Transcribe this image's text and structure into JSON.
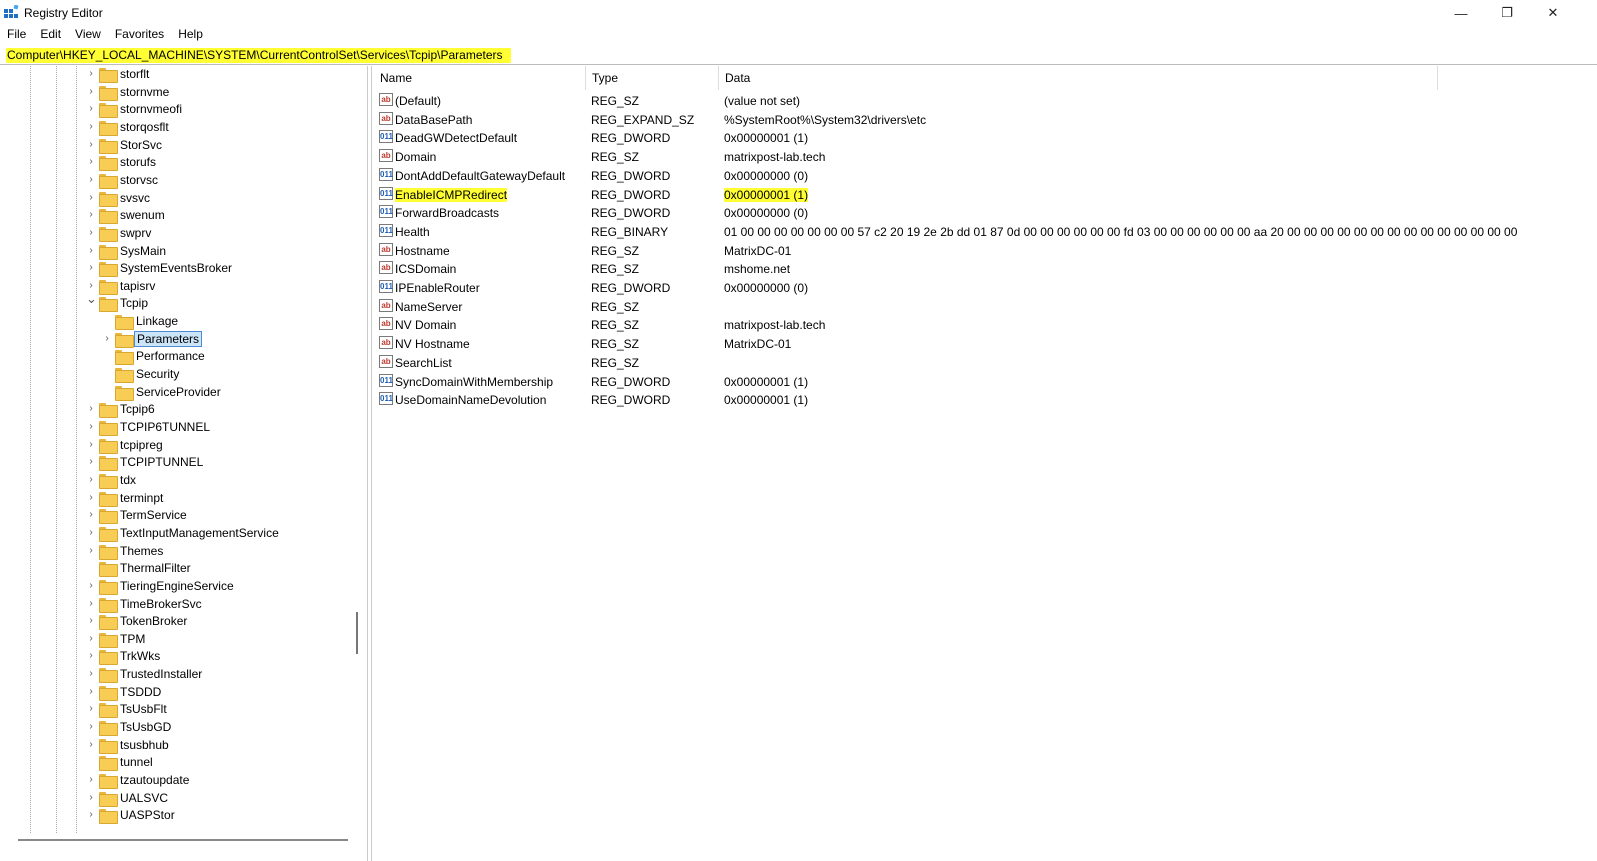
{
  "window": {
    "title": "Registry Editor",
    "minimize_glyph": "—",
    "maximize_glyph": "❐",
    "close_glyph": "✕"
  },
  "menu": [
    "File",
    "Edit",
    "View",
    "Favorites",
    "Help"
  ],
  "address": {
    "path": "Computer\\HKEY_LOCAL_MACHINE\\SYSTEM\\CurrentControlSet\\Services\\Tcpip\\Parameters",
    "highlight_color": "#ffff33"
  },
  "tree": {
    "items": [
      {
        "label": "storflt",
        "expandable": true,
        "level": 0
      },
      {
        "label": "stornvme",
        "expandable": true,
        "level": 0
      },
      {
        "label": "stornvmeofi",
        "expandable": true,
        "level": 0
      },
      {
        "label": "storqosflt",
        "expandable": true,
        "level": 0
      },
      {
        "label": "StorSvc",
        "expandable": true,
        "level": 0
      },
      {
        "label": "storufs",
        "expandable": true,
        "level": 0
      },
      {
        "label": "storvsc",
        "expandable": true,
        "level": 0
      },
      {
        "label": "svsvc",
        "expandable": true,
        "level": 0
      },
      {
        "label": "swenum",
        "expandable": true,
        "level": 0
      },
      {
        "label": "swprv",
        "expandable": true,
        "level": 0
      },
      {
        "label": "SysMain",
        "expandable": true,
        "level": 0
      },
      {
        "label": "SystemEventsBroker",
        "expandable": true,
        "level": 0
      },
      {
        "label": "tapisrv",
        "expandable": true,
        "level": 0
      },
      {
        "label": "Tcpip",
        "expandable": true,
        "expanded": true,
        "level": 0
      },
      {
        "label": "Linkage",
        "expandable": false,
        "level": 1
      },
      {
        "label": "Parameters",
        "expandable": true,
        "level": 1,
        "selected": true
      },
      {
        "label": "Performance",
        "expandable": false,
        "level": 1
      },
      {
        "label": "Security",
        "expandable": false,
        "level": 1
      },
      {
        "label": "ServiceProvider",
        "expandable": false,
        "level": 1
      },
      {
        "label": "Tcpip6",
        "expandable": true,
        "level": 0
      },
      {
        "label": "TCPIP6TUNNEL",
        "expandable": true,
        "level": 0
      },
      {
        "label": "tcpipreg",
        "expandable": true,
        "level": 0
      },
      {
        "label": "TCPIPTUNNEL",
        "expandable": true,
        "level": 0
      },
      {
        "label": "tdx",
        "expandable": true,
        "level": 0
      },
      {
        "label": "terminpt",
        "expandable": true,
        "level": 0
      },
      {
        "label": "TermService",
        "expandable": true,
        "level": 0
      },
      {
        "label": "TextInputManagementService",
        "expandable": true,
        "level": 0
      },
      {
        "label": "Themes",
        "expandable": true,
        "level": 0
      },
      {
        "label": "ThermalFilter",
        "expandable": false,
        "level": 0
      },
      {
        "label": "TieringEngineService",
        "expandable": true,
        "level": 0
      },
      {
        "label": "TimeBrokerSvc",
        "expandable": true,
        "level": 0
      },
      {
        "label": "TokenBroker",
        "expandable": true,
        "level": 0
      },
      {
        "label": "TPM",
        "expandable": true,
        "level": 0
      },
      {
        "label": "TrkWks",
        "expandable": true,
        "level": 0
      },
      {
        "label": "TrustedInstaller",
        "expandable": true,
        "level": 0
      },
      {
        "label": "TSDDD",
        "expandable": true,
        "level": 0
      },
      {
        "label": "TsUsbFlt",
        "expandable": true,
        "level": 0
      },
      {
        "label": "TsUsbGD",
        "expandable": true,
        "level": 0
      },
      {
        "label": "tsusbhub",
        "expandable": true,
        "level": 0
      },
      {
        "label": "tunnel",
        "expandable": false,
        "level": 0
      },
      {
        "label": "tzautoupdate",
        "expandable": true,
        "level": 0
      },
      {
        "label": "UALSVC",
        "expandable": true,
        "level": 0
      },
      {
        "label": "UASPStor",
        "expandable": true,
        "level": 0
      }
    ]
  },
  "list": {
    "headers": {
      "name": "Name",
      "type": "Type",
      "data": "Data"
    },
    "rows": [
      {
        "name": "(Default)",
        "type": "REG_SZ",
        "data": "(value not set)",
        "icon": "string-value-icon"
      },
      {
        "name": "DataBasePath",
        "type": "REG_EXPAND_SZ",
        "data": "%SystemRoot%\\System32\\drivers\\etc",
        "icon": "string-value-icon"
      },
      {
        "name": "DeadGWDetectDefault",
        "type": "REG_DWORD",
        "data": "0x00000001 (1)",
        "icon": "binary-value-icon"
      },
      {
        "name": "Domain",
        "type": "REG_SZ",
        "data": "matrixpost-lab.tech",
        "icon": "string-value-icon"
      },
      {
        "name": "DontAddDefaultGatewayDefault",
        "type": "REG_DWORD",
        "data": "0x00000000 (0)",
        "icon": "binary-value-icon"
      },
      {
        "name": "EnableICMPRedirect",
        "type": "REG_DWORD",
        "data": "0x00000001 (1)",
        "icon": "binary-value-icon",
        "highlighted": true
      },
      {
        "name": "ForwardBroadcasts",
        "type": "REG_DWORD",
        "data": "0x00000000 (0)",
        "icon": "binary-value-icon"
      },
      {
        "name": "Health",
        "type": "REG_BINARY",
        "data": "01 00 00 00 00 00 00 00 57 c2 20 19 2e 2b dd 01 87 0d 00 00 00 00 00 00 fd 03 00 00 00 00 00 00 aa 20 00 00 00 00 00 00 00 00 00 00 00 00 00 00",
        "icon": "binary-value-icon"
      },
      {
        "name": "Hostname",
        "type": "REG_SZ",
        "data": "MatrixDC-01",
        "icon": "string-value-icon"
      },
      {
        "name": "ICSDomain",
        "type": "REG_SZ",
        "data": "mshome.net",
        "icon": "string-value-icon"
      },
      {
        "name": "IPEnableRouter",
        "type": "REG_DWORD",
        "data": "0x00000000 (0)",
        "icon": "binary-value-icon"
      },
      {
        "name": "NameServer",
        "type": "REG_SZ",
        "data": "",
        "icon": "string-value-icon"
      },
      {
        "name": "NV Domain",
        "type": "REG_SZ",
        "data": "matrixpost-lab.tech",
        "icon": "string-value-icon"
      },
      {
        "name": "NV Hostname",
        "type": "REG_SZ",
        "data": "MatrixDC-01",
        "icon": "string-value-icon"
      },
      {
        "name": "SearchList",
        "type": "REG_SZ",
        "data": "",
        "icon": "string-value-icon"
      },
      {
        "name": "SyncDomainWithMembership",
        "type": "REG_DWORD",
        "data": "0x00000001 (1)",
        "icon": "binary-value-icon"
      },
      {
        "name": "UseDomainNameDevolution",
        "type": "REG_DWORD",
        "data": "0x00000001 (1)",
        "icon": "binary-value-icon"
      }
    ]
  }
}
